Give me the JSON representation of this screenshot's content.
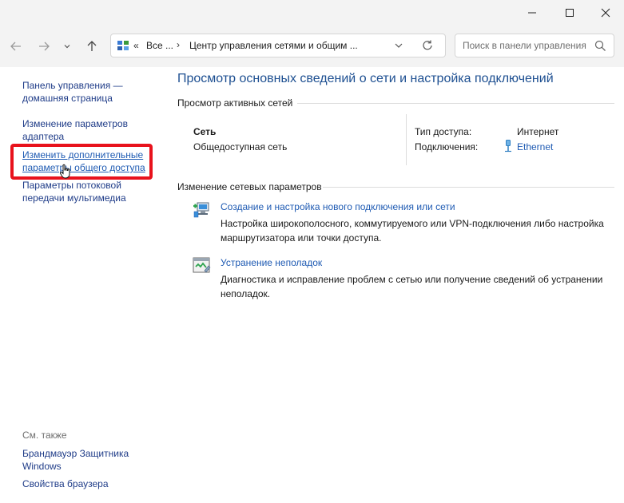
{
  "toolbar": {
    "breadcrumb_overflow": "«",
    "breadcrumb_root": "Все ...",
    "breadcrumb_sep": "›",
    "breadcrumb_current": "Центр управления сетями и общим ...",
    "search_placeholder": "Поиск в панели управления"
  },
  "sidebar": {
    "items": [
      {
        "label": "Панель управления — домашняя страница"
      },
      {
        "label": "Изменение параметров адаптера"
      },
      {
        "label": "Изменить дополнительные параметры общего доступа"
      },
      {
        "label": "Параметры потоковой передачи мультимедиа"
      }
    ],
    "see_also_title": "См. также",
    "see_also": [
      {
        "label": "Брандмауэр Защитника Windows"
      },
      {
        "label": "Свойства браузера"
      }
    ]
  },
  "main": {
    "title": "Просмотр основных сведений о сети и настройка подключений",
    "active_networks_header": "Просмотр активных сетей",
    "network": {
      "name": "Сеть",
      "category": "Общедоступная сеть",
      "access_type_label": "Тип доступа:",
      "access_type_value": "Интернет",
      "connections_label": "Подключения:",
      "connection_name": "Ethernet"
    },
    "change_settings_header": "Изменение сетевых параметров",
    "tasks": [
      {
        "title": "Создание и настройка нового подключения или сети",
        "description": "Настройка широкополосного, коммутируемого или VPN-подключения либо настройка маршрутизатора или точки доступа.",
        "icon": "new-connection-icon"
      },
      {
        "title": "Устранение неполадок",
        "description": "Диагностика и исправление проблем с сетью или получение сведений об устранении неполадок.",
        "icon": "troubleshoot-icon"
      }
    ]
  },
  "colors": {
    "link": "#1f5bb3",
    "title": "#1d4f91",
    "highlight": "#e8121c"
  }
}
